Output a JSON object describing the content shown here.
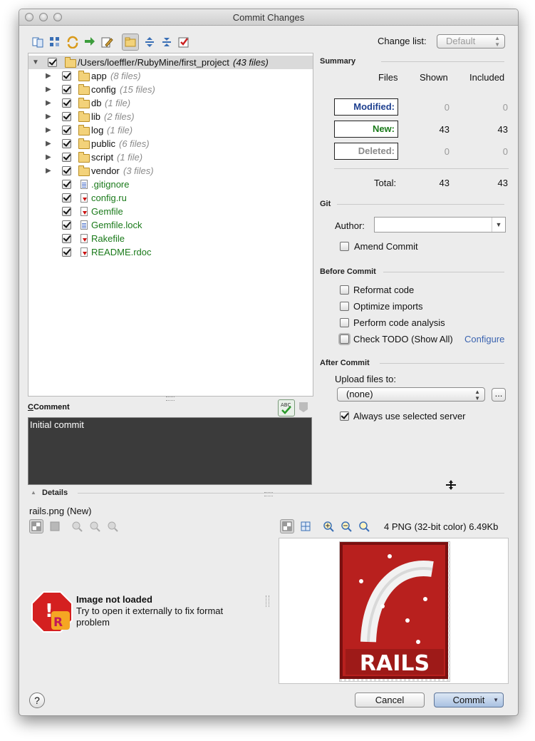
{
  "window": {
    "title": "Commit Changes"
  },
  "toolbar": {
    "icons": [
      "diff-icon",
      "group-icon",
      "refresh-icon",
      "move-icon",
      "edit-icon",
      "folder-view-icon",
      "expand-all-icon",
      "collapse-all-icon",
      "select-icon"
    ],
    "change_list_label": "Change list:",
    "change_list_value": "Default"
  },
  "tree": {
    "root": {
      "path": "/Users/loeffler/RubyMine/first_project",
      "count": "(43 files)"
    },
    "folders": [
      {
        "name": "app",
        "count": "(8 files)"
      },
      {
        "name": "config",
        "count": "(15 files)"
      },
      {
        "name": "db",
        "count": "(1 file)"
      },
      {
        "name": "lib",
        "count": "(2 files)"
      },
      {
        "name": "log",
        "count": "(1 file)"
      },
      {
        "name": "public",
        "count": "(6 files)"
      },
      {
        "name": "script",
        "count": "(1 file)"
      },
      {
        "name": "vendor",
        "count": "(3 files)"
      }
    ],
    "files": [
      ".gitignore",
      "config.ru",
      "Gemfile",
      "Gemfile.lock",
      "Rakefile",
      "README.rdoc"
    ]
  },
  "comment": {
    "label": "Comment",
    "text": "Initial commit"
  },
  "summary": {
    "title": "Summary",
    "headers": [
      "Files",
      "Shown",
      "Included"
    ],
    "rows": [
      {
        "label": "Modified:",
        "shown": "0",
        "included": "0",
        "color": "#1d3f8f"
      },
      {
        "label": "New:",
        "shown": "43",
        "included": "43",
        "color": "#1a7a1a"
      },
      {
        "label": "Deleted:",
        "shown": "0",
        "included": "0",
        "color": "#8a8a8a"
      }
    ],
    "total_label": "Total:",
    "total_shown": "43",
    "total_included": "43"
  },
  "git": {
    "title": "Git",
    "author_label": "Author:",
    "author_value": "",
    "amend_label": "Amend Commit"
  },
  "before_commit": {
    "title": "Before Commit",
    "options": [
      "Reformat code",
      "Optimize imports",
      "Perform code analysis",
      "Check TODO (Show All)"
    ],
    "configure_link": "Configure"
  },
  "after_commit": {
    "title": "After Commit",
    "upload_label": "Upload files to:",
    "upload_value": "(none)",
    "browse_label": "...",
    "always_label": "Always use selected server"
  },
  "details": {
    "title": "Details",
    "file_label": "rails.png (New)",
    "image_info": "4 PNG (32-bit color) 6.49Kb",
    "error_title": "Image not loaded",
    "error_text_1": "Try to open it externally to fix format",
    "error_text_2": "problem",
    "logo_text": "RAILS"
  },
  "footer": {
    "help": "?",
    "cancel": "Cancel",
    "commit": "Commit"
  },
  "colors": {
    "accent_link": "#3b64b0",
    "file_new": "#1a7a1a",
    "comment_bg": "#3b3b3b"
  }
}
